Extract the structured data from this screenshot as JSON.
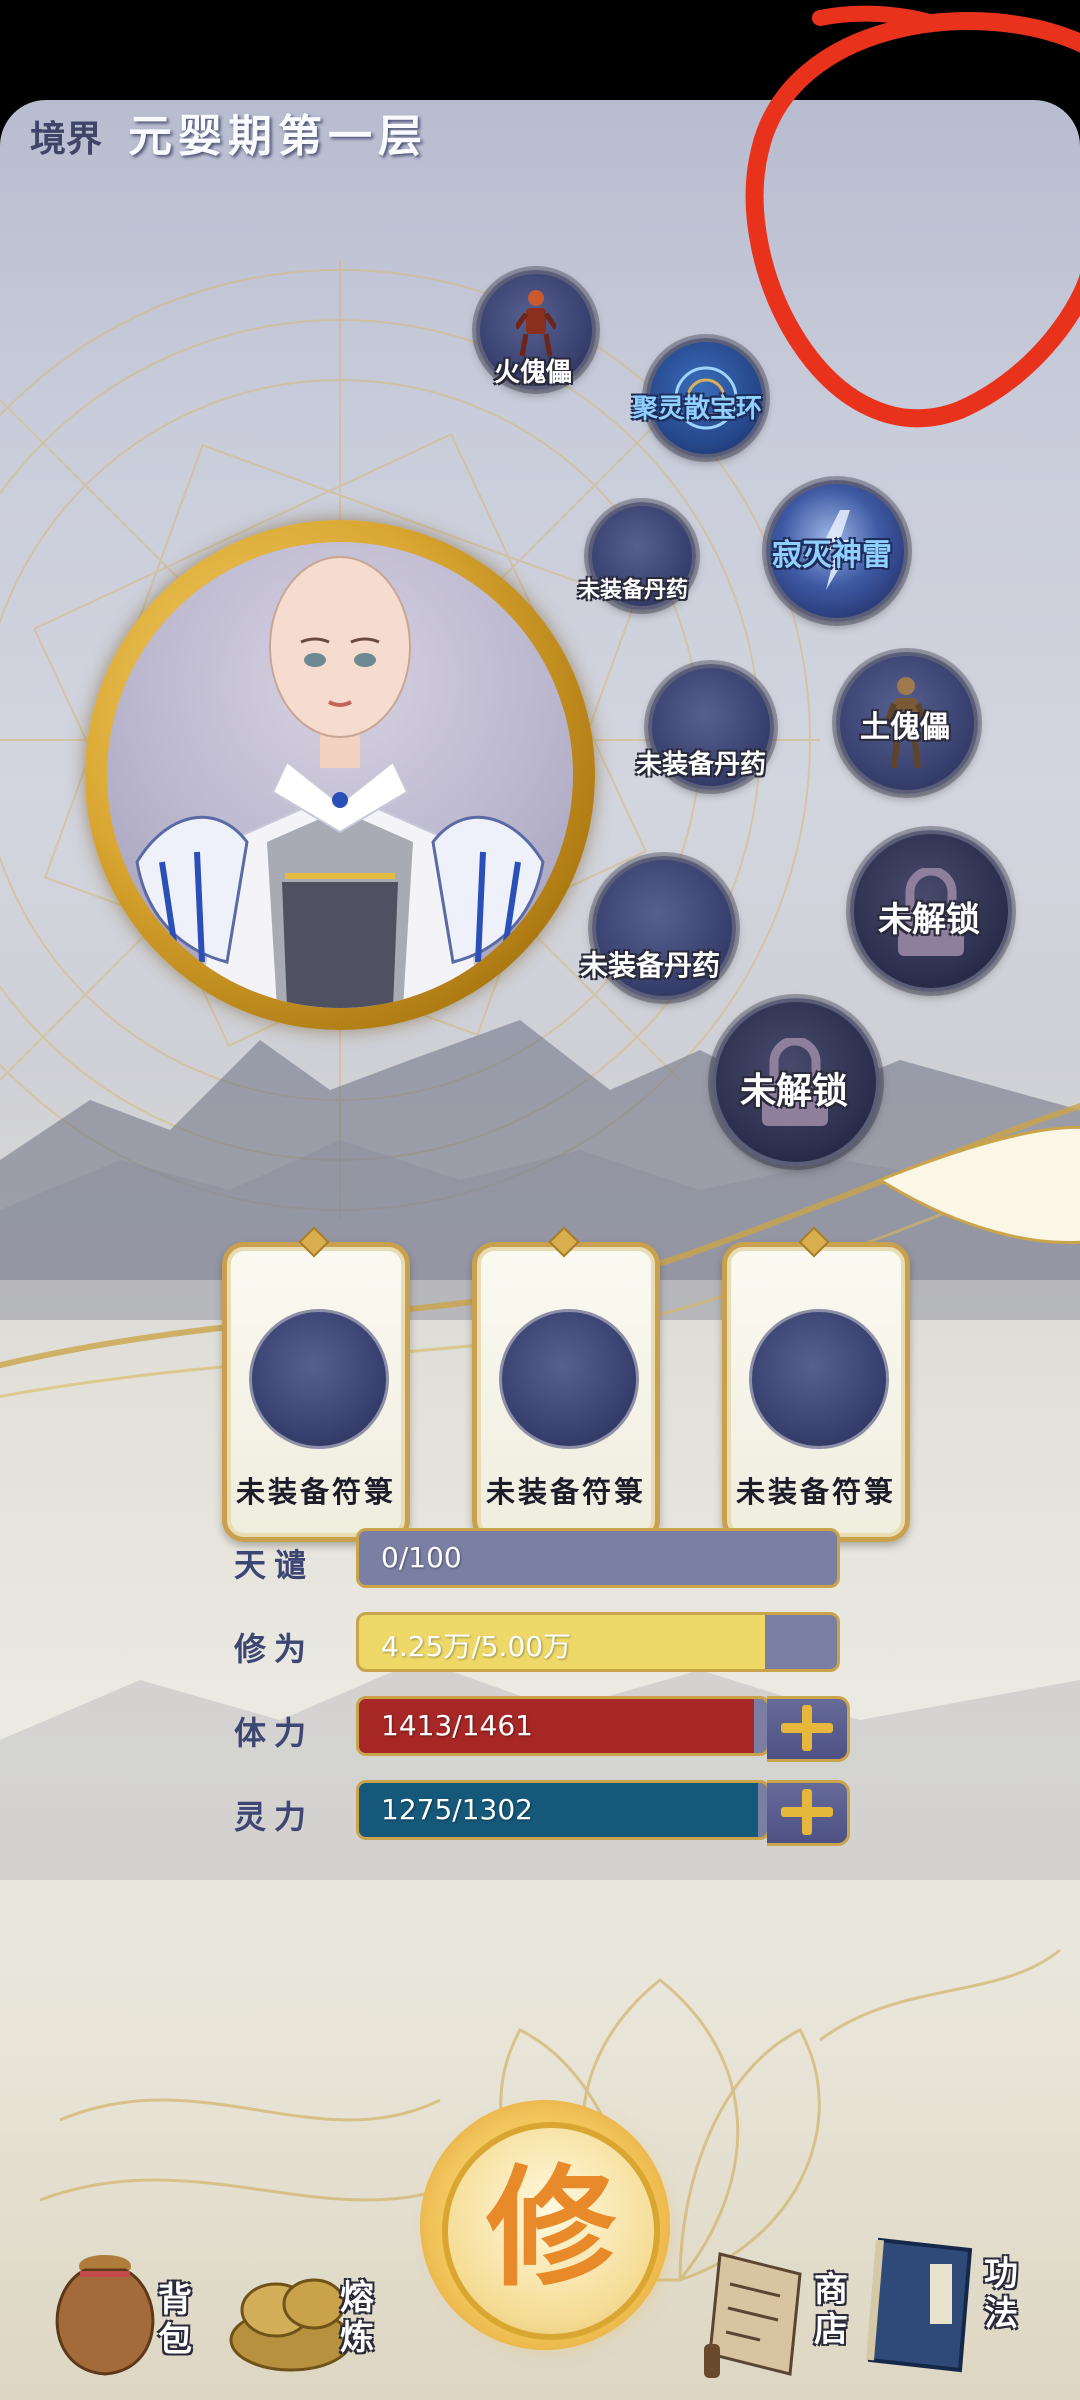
{
  "header": {
    "realm_label": "境界",
    "realm_value": "元婴期第一层"
  },
  "skills": [
    {
      "label": "火傀儡",
      "icon": "fire-puppet-icon"
    },
    {
      "label": "聚灵散宝环",
      "icon": "spirit-ring-icon"
    },
    {
      "label": "未装备丹药"
    },
    {
      "label": "寂灭神雷",
      "icon": "lightning-orb-icon"
    },
    {
      "label": "未装备丹药"
    },
    {
      "label": "土傀儡",
      "icon": "earth-puppet-icon"
    },
    {
      "label": "未装备丹药"
    },
    {
      "label": "未解锁",
      "icon": "lock-icon"
    },
    {
      "label": "未解锁",
      "icon": "lock-icon"
    }
  ],
  "talismans": [
    {
      "label": "未装备符箓"
    },
    {
      "label": "未装备符箓"
    },
    {
      "label": "未装备符箓"
    }
  ],
  "stats": [
    {
      "label": "天谴",
      "text": "0/100",
      "fraction": 0.0,
      "color": "#7a7fa3"
    },
    {
      "label": "修为",
      "text": "4.25万/5.00万",
      "fraction": 0.85,
      "color": "#eed868"
    },
    {
      "label": "体力",
      "text": "1413/1461",
      "fraction": 0.967,
      "color": "#a72626"
    },
    {
      "label": "灵力",
      "text": "1275/1302",
      "fraction": 0.979,
      "color": "#15587a"
    }
  ],
  "cultivate_button": {
    "glyph": "修"
  },
  "bottom_nav": {
    "bag": "背包",
    "refine": "熔炼",
    "shop": "商店",
    "skills": "功法"
  },
  "colors": {
    "annotation_red": "#e8321c",
    "gold": "#d9a631"
  }
}
